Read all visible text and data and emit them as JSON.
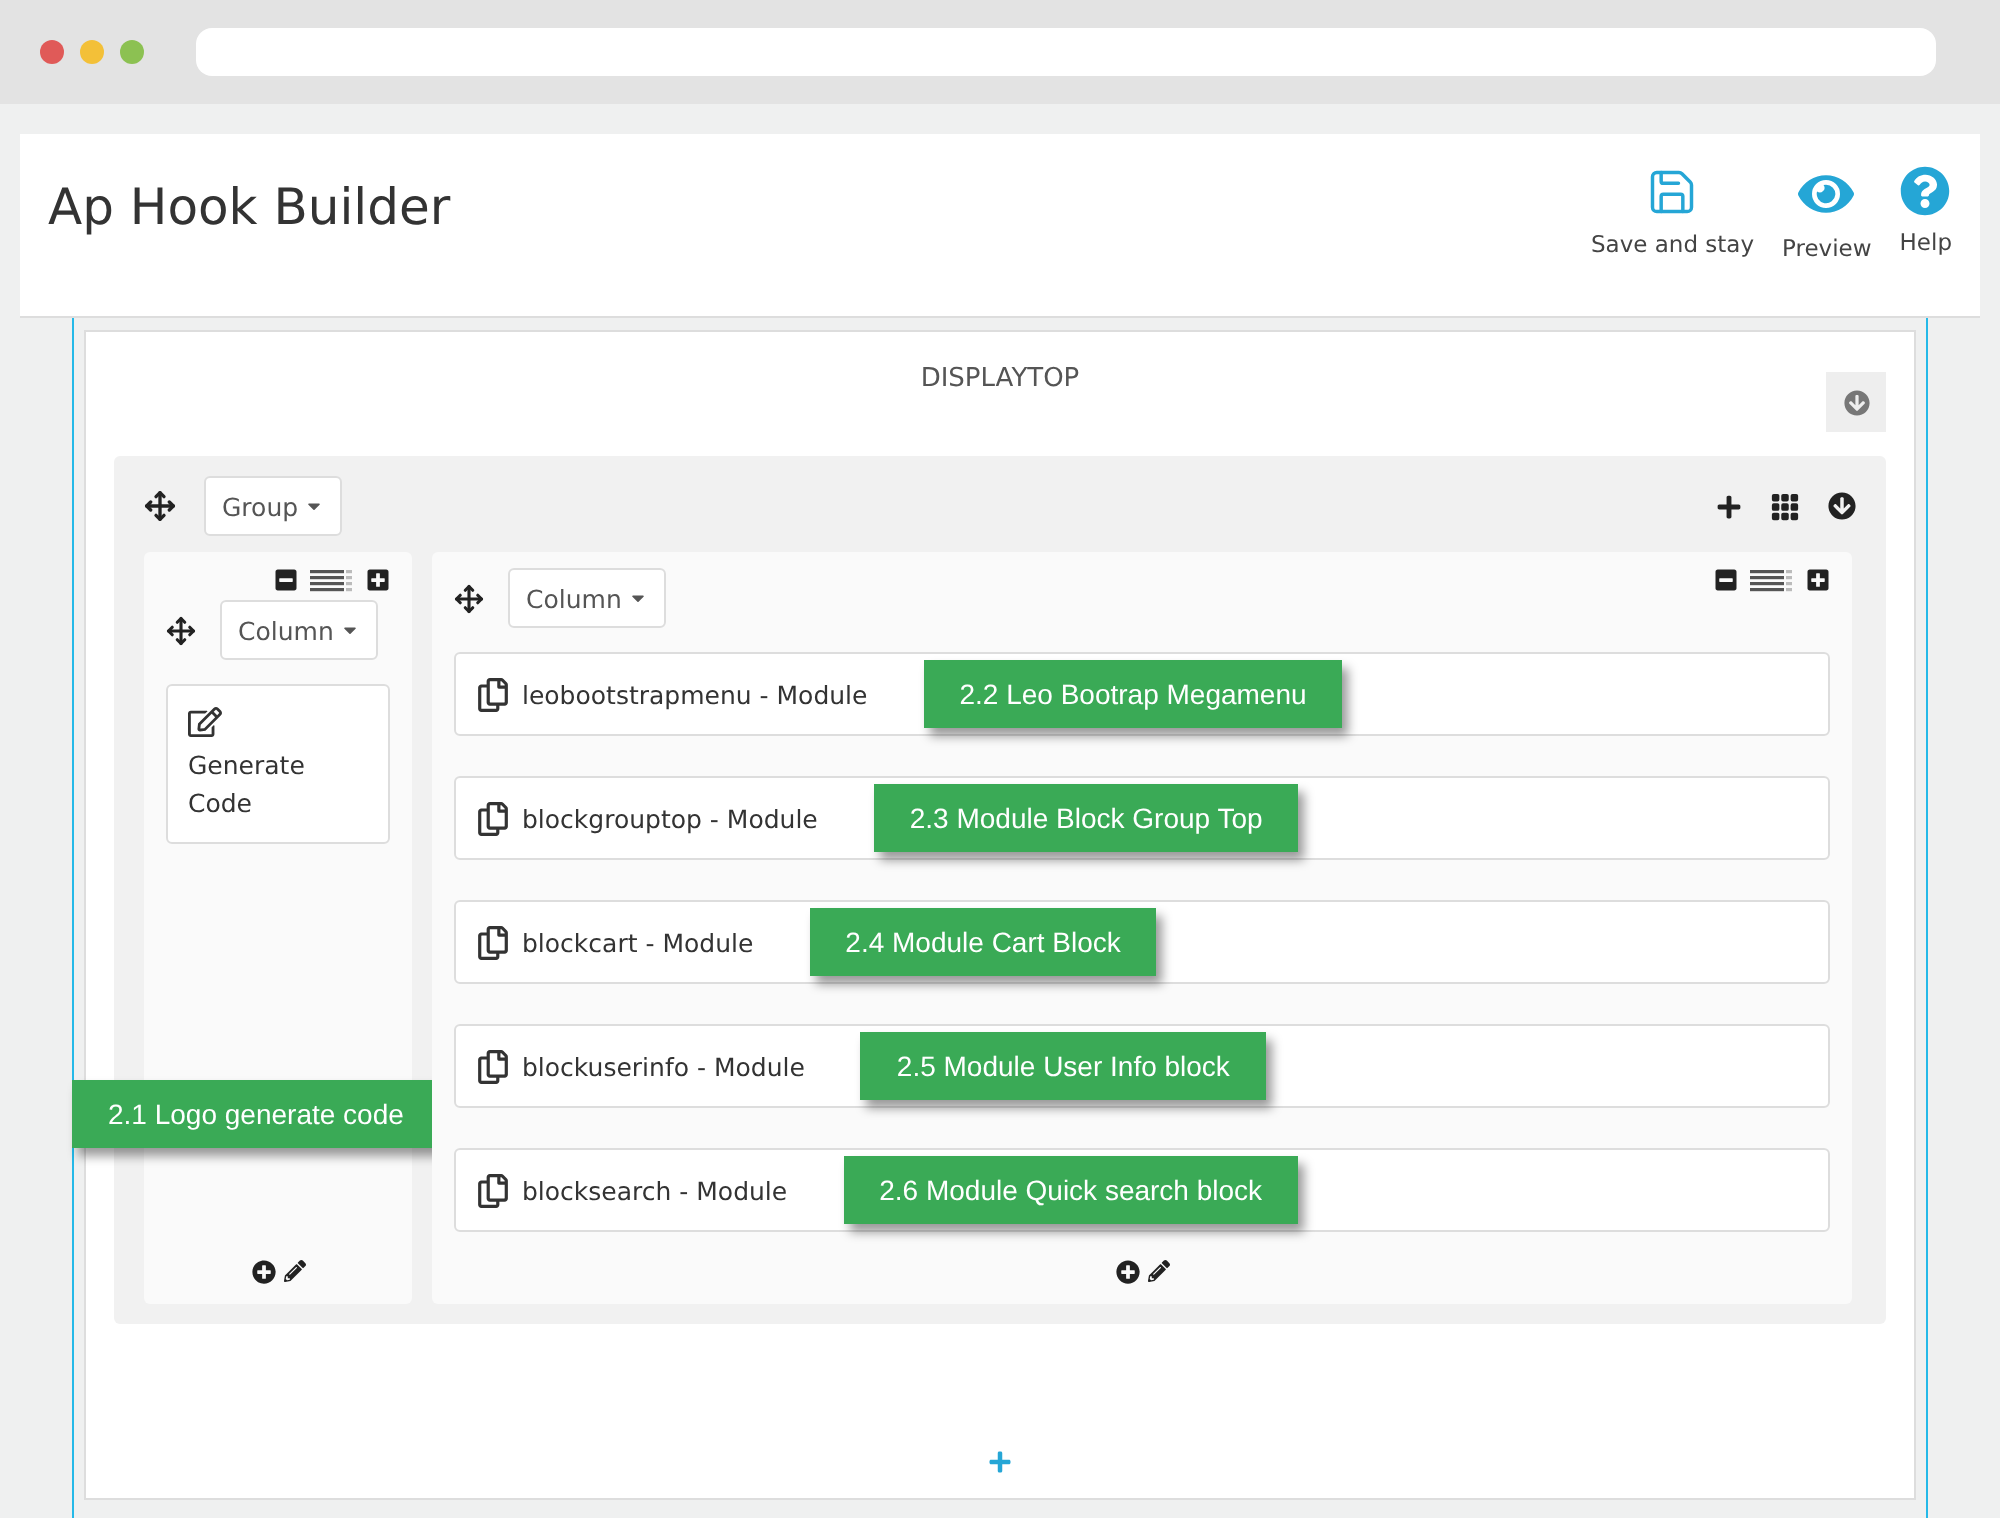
{
  "window": {
    "title": "Ap Hook Builder"
  },
  "toolbar": [
    {
      "kind": "save",
      "label": "Save and stay"
    },
    {
      "kind": "preview",
      "label": "Preview"
    },
    {
      "kind": "help",
      "label": "Help"
    }
  ],
  "hook": {
    "title": "DISPLAYTOP",
    "group": {
      "label": "Group",
      "columns": [
        {
          "label": "Column",
          "widgets": [
            {
              "kind": "widget",
              "name": "Generate Code",
              "note": "2.1 Logo generate code"
            }
          ]
        },
        {
          "label": "Column",
          "widgets": [
            {
              "kind": "module",
              "name": "leobootstrapmenu - Module",
              "note": "2.2 Leo Bootrap Megamenu"
            },
            {
              "kind": "module",
              "name": "blockgrouptop - Module",
              "note": "2.3  Module Block Group Top"
            },
            {
              "kind": "module",
              "name": "blockcart - Module",
              "note": "2.4 Module Cart Block"
            },
            {
              "kind": "module",
              "name": "blockuserinfo - Module",
              "note": "2.5  Module User Info block"
            },
            {
              "kind": "module",
              "name": "blocksearch - Module",
              "note": "2.6 Module Quick search block"
            }
          ]
        }
      ]
    }
  }
}
